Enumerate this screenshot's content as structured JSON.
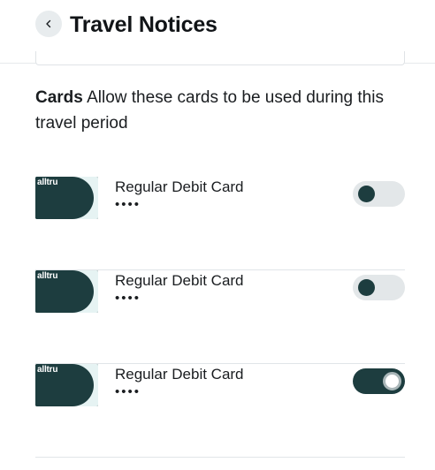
{
  "header": {
    "title": "Travel Notices",
    "back_icon": "chevron-left-icon"
  },
  "section": {
    "heading": "Cards",
    "description": "Allow these cards to be used during this travel period"
  },
  "cards": [
    {
      "logo": "alltru",
      "name": "Regular Debit Card",
      "mask": "••••",
      "enabled": false
    },
    {
      "logo": "alltru",
      "name": "Regular Debit Card",
      "mask": "••••",
      "enabled": false
    },
    {
      "logo": "alltru",
      "name": "Regular Debit Card",
      "mask": "••••",
      "enabled": true
    }
  ],
  "colors": {
    "brand_dark": "#1d3d3f",
    "card_light": "#e6f3f3",
    "toggle_off_track": "#e3e7e9",
    "toggle_on_ring": "#a9b6b8"
  }
}
